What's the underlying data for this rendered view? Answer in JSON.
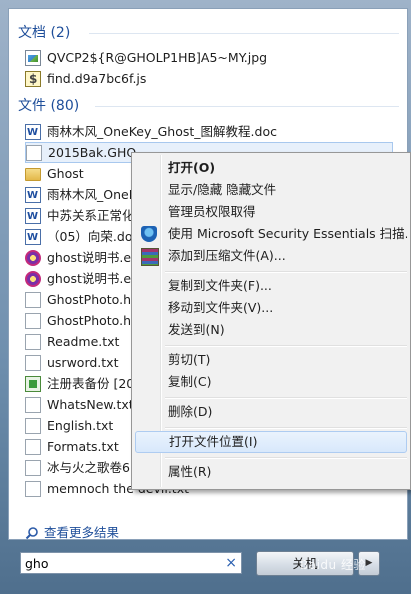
{
  "docs_group": {
    "header": "文档 (2)",
    "items": [
      {
        "label": "QVCP2${R@GHOLP1HB]A5~MY.jpg",
        "icon": "image-file-icon"
      },
      {
        "label": "find.d9a7bc6f.js",
        "icon": "script-file-icon"
      }
    ]
  },
  "files_group": {
    "header": "文件 (80)",
    "items": [
      {
        "label": "雨林木风_OneKey_Ghost_图解教程.doc",
        "icon": "word-doc-icon"
      },
      {
        "label": "2015Bak.GHO",
        "icon": "blank-file-icon"
      },
      {
        "label": "Ghost",
        "icon": "folder-icon"
      },
      {
        "label": "雨林木风_OneK",
        "icon": "word-doc-icon"
      },
      {
        "label": "中苏关系正常化",
        "icon": "word-doc-icon"
      },
      {
        "label": "（05）向荣.do",
        "icon": "word-doc-icon"
      },
      {
        "label": "ghost说明书.ex",
        "icon": "exe-file-icon"
      },
      {
        "label": "ghost说明书.ex",
        "icon": "exe-file-icon"
      },
      {
        "label": "GhostPhoto.hf",
        "icon": "blank-file-icon"
      },
      {
        "label": "GhostPhoto.hf",
        "icon": "blank-file-icon"
      },
      {
        "label": "Readme.txt",
        "icon": "text-file-icon"
      },
      {
        "label": "usrword.txt",
        "icon": "text-file-icon"
      },
      {
        "label": "注册表备份 [20",
        "icon": "registry-file-icon"
      },
      {
        "label": "WhatsNew.txt",
        "icon": "text-file-icon"
      },
      {
        "label": "English.txt",
        "icon": "text-file-icon"
      },
      {
        "label": "Formats.txt",
        "icon": "text-file-icon"
      },
      {
        "label": "冰与火之歌卷6",
        "icon": "text-file-icon"
      },
      {
        "label": "memnoch the devil.txt",
        "icon": "text-file-icon"
      }
    ]
  },
  "see_more": "查看更多结果",
  "search": {
    "value": "gho"
  },
  "shutdown_label": "关机",
  "watermark": "Baidu 经验",
  "context_menu": {
    "items": [
      {
        "label": "打开(O)",
        "bold": true
      },
      {
        "label": "显示/隐藏 隐藏文件"
      },
      {
        "label": "管理员权限取得"
      },
      {
        "label": "使用 Microsoft Security Essentials 扫描...",
        "icon": "shield-icon"
      },
      {
        "label": "添加到压缩文件(A)...",
        "icon": "winrar-icon"
      },
      {
        "label": "复制到文件夹(F)..."
      },
      {
        "label": "移动到文件夹(V)..."
      },
      {
        "label": "发送到(N)"
      },
      {
        "label": "剪切(T)"
      },
      {
        "label": "复制(C)"
      },
      {
        "label": "删除(D)"
      },
      {
        "label": "打开文件位置(I)",
        "highlighted": true
      },
      {
        "label": "属性(R)"
      }
    ]
  }
}
